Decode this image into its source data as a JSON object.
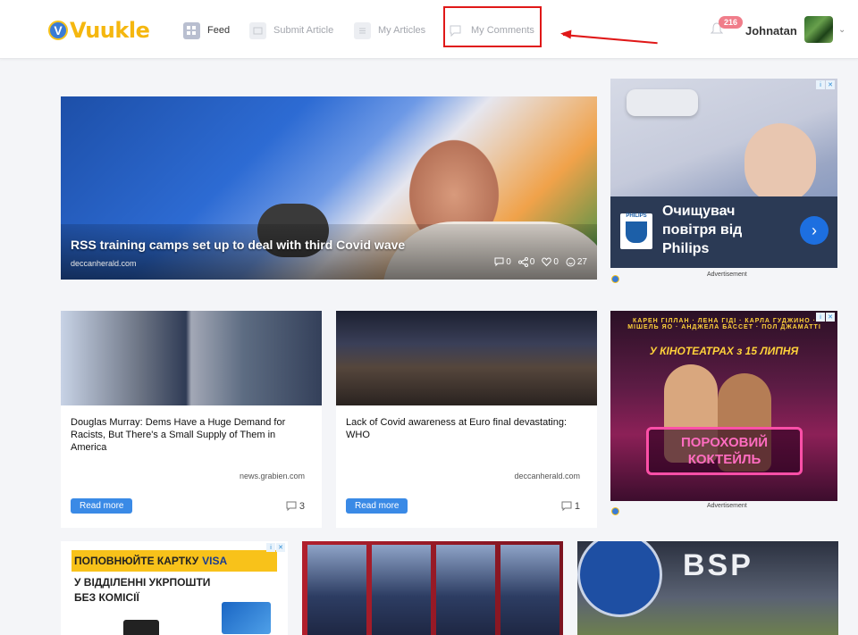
{
  "header": {
    "logo_text": "Vuukle",
    "logo_badge": "V",
    "nav": [
      {
        "label": "Feed"
      },
      {
        "label": "Submit Article"
      },
      {
        "label": "My Articles"
      },
      {
        "label": "My Comments"
      }
    ],
    "notification_count": "216",
    "username": "Johnatan"
  },
  "hero": {
    "title": "RSS training camps set up to deal with third Covid wave",
    "source": "deccanherald.com",
    "stats": {
      "comments": "0",
      "shares": "0",
      "likes": "0",
      "reactions": "27"
    }
  },
  "ads": {
    "label": "Advertisement",
    "philips": {
      "headline": "Очищувач повітря від Philips",
      "brand": "PHILIPS"
    },
    "movie": {
      "names": "КАРЕН ГІЛЛАН · ЛЕНА ГІДІ · КАРЛА ГУДЖИНО · МІШЕЛЬ ЯО · АНДЖЕЛА БАССЕТ · ПОЛ ДЖАМАТТІ",
      "date": "У КІНОТЕАТРАХ з 15 ЛИПНЯ",
      "title": "ПОРОХОВИЙ КОКТЕЙЛЬ"
    },
    "visa": {
      "band_text": "ПОПОВНЮЙТЕ КАРТКУ",
      "brand": "VISA",
      "sub_line1": "У ВІДДІЛЕННІ УКРПОШТИ",
      "sub_line2": "БЕЗ КОМІСІЇ"
    },
    "bsp": {
      "text": "BSP"
    }
  },
  "cards": [
    {
      "title": "Douglas Murray: Dems Have a Huge Demand for Racists, But There's a Small Supply of Them in America",
      "source": "news.grabien.com",
      "button": "Read more",
      "comments": "3"
    },
    {
      "title": "Lack of Covid awareness at Euro final devastating: WHO",
      "source": "deccanherald.com",
      "button": "Read more",
      "comments": "1"
    }
  ],
  "colors": {
    "accent": "#3a8ae6",
    "logo_yellow": "#f5b70f",
    "annotation_red": "#e01818",
    "badge_pink": "#f07d8a"
  }
}
